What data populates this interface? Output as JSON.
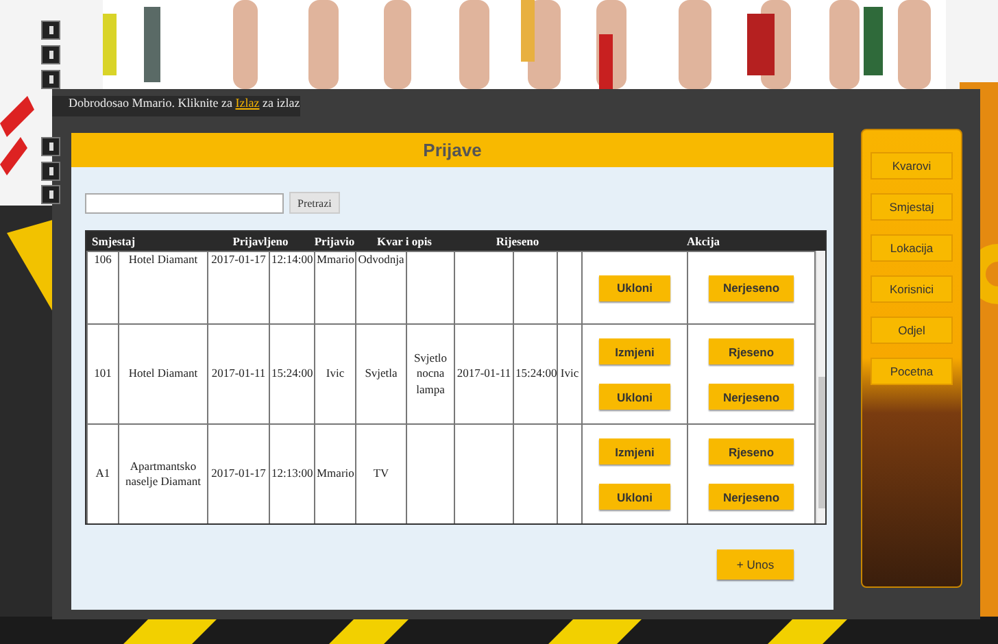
{
  "welcome": {
    "before": "Dobrodosao Mmario. Kliknite za",
    "link": "Izlaz",
    "after": "za izlaz"
  },
  "title": "Prijave",
  "search": {
    "button": "Pretrazi"
  },
  "table": {
    "headers": [
      "Smjestaj",
      "Prijavljeno",
      "Prijavio",
      "Kvar i opis",
      "Rijeseno",
      "Akcija"
    ],
    "rows": [
      {
        "room": "106",
        "place": "Hotel Diamant",
        "reported_date": "2017-01-17",
        "reported_time": "12:14:00",
        "reported_by": "Mmario",
        "fault": "Odvodnja",
        "actions_1": [
          "Ukloni"
        ],
        "actions_2": [
          "Nerjeseno"
        ]
      },
      {
        "room": "101",
        "place": "Hotel Diamant",
        "reported_date": "2017-01-11",
        "reported_time": "15:24:00",
        "reported_by": "Ivic",
        "fault": "Svjetla",
        "description": "Svjetlo nocna lampa",
        "resolved_date": "2017-01-11",
        "resolved_time": "15:24:00",
        "resolved_by": "Ivic",
        "actions_1": [
          "Izmjeni",
          "Ukloni"
        ],
        "actions_2": [
          "Rjeseno",
          "Nerjeseno"
        ]
      },
      {
        "room": "A1",
        "place": "Apartmantsko naselje Diamant",
        "reported_date": "2017-01-17",
        "reported_time": "12:13:00",
        "reported_by": "Mmario",
        "fault": "TV",
        "actions_1": [
          "Izmjeni",
          "Ukloni"
        ],
        "actions_2": [
          "Rjeseno",
          "Nerjeseno"
        ]
      }
    ]
  },
  "add_button": "+ Unos",
  "sidebar": {
    "items": [
      "Kvarovi",
      "Smjestaj",
      "Lokacija",
      "Korisnici",
      "Odjel",
      "Pocetna"
    ]
  }
}
